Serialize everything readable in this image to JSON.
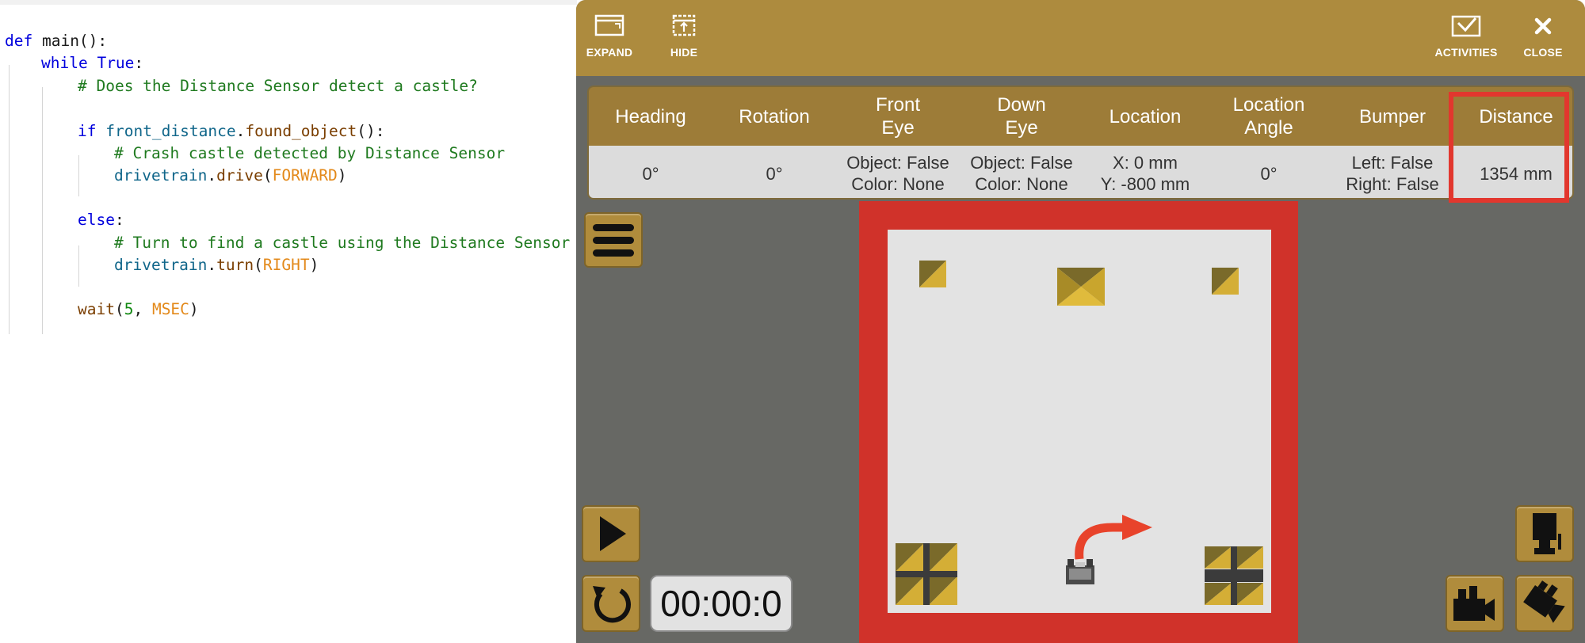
{
  "editor": {
    "lines": [
      {
        "parts": [
          [
            "kw",
            "def "
          ],
          [
            "plain",
            "main():"
          ]
        ]
      },
      {
        "parts": [
          [
            "kw",
            "while "
          ],
          [
            "kw",
            "True"
          ],
          [
            "plain",
            ":"
          ]
        ]
      },
      {
        "parts": [
          [
            "cm",
            "# Does the Distance Sensor detect a castle?"
          ]
        ]
      },
      {
        "parts": []
      },
      {
        "parts": [
          [
            "kw",
            "if "
          ],
          [
            "var",
            "front_distance"
          ],
          [
            "plain",
            "."
          ],
          [
            "fn",
            "found_object"
          ],
          [
            "plain",
            "():"
          ]
        ]
      },
      {
        "parts": [
          [
            "cm",
            "# Crash castle detected by Distance Sensor"
          ]
        ]
      },
      {
        "parts": [
          [
            "var",
            "drivetrain"
          ],
          [
            "plain",
            "."
          ],
          [
            "fn",
            "drive"
          ],
          [
            "plain",
            "("
          ],
          [
            "const",
            "FORWARD"
          ],
          [
            "plain",
            ")"
          ]
        ]
      },
      {
        "parts": []
      },
      {
        "parts": [
          [
            "kw",
            "else"
          ],
          [
            "plain",
            ":"
          ]
        ]
      },
      {
        "parts": [
          [
            "cm",
            "# Turn to find a castle using the Distance Sensor"
          ]
        ]
      },
      {
        "parts": [
          [
            "var",
            "drivetrain"
          ],
          [
            "plain",
            "."
          ],
          [
            "fn",
            "turn"
          ],
          [
            "plain",
            "("
          ],
          [
            "const",
            "RIGHT"
          ],
          [
            "plain",
            ")"
          ]
        ]
      },
      {
        "parts": []
      },
      {
        "parts": [
          [
            "fn",
            "wait"
          ],
          [
            "plain",
            "("
          ],
          [
            "num",
            "5"
          ],
          [
            "plain",
            ", "
          ],
          [
            "const",
            "MSEC"
          ],
          [
            "plain",
            ")"
          ]
        ]
      }
    ]
  },
  "toolbar": {
    "expand_label": "EXPAND",
    "hide_label": "HIDE",
    "activities_label": "ACTIVITIES",
    "close_label": "CLOSE"
  },
  "sensors": {
    "headers": [
      "Heading",
      "Rotation",
      "Front\nEye",
      "Down\nEye",
      "Location",
      "Location\nAngle",
      "Bumper",
      "Distance"
    ],
    "values": [
      "0°",
      "0°",
      "Object: False\nColor: None",
      "Object: False\nColor: None",
      "X: 0 mm\nY: -800 mm",
      "0°",
      "Left: False\nRight: False",
      "1354 mm"
    ]
  },
  "controls": {
    "timer": "00:00:0",
    "icons": {
      "menu": "menu-icon",
      "play": "play-icon",
      "reset": "reset-icon",
      "robot_view": "robot-view-icon",
      "camera": "camera-icon",
      "camera_rotate": "camera-rotate-icon"
    }
  },
  "colors": {
    "toolbar": "#ad8b3e",
    "field_border": "#d0322a",
    "highlight": "#e2372e",
    "arrow": "#e8432b"
  }
}
